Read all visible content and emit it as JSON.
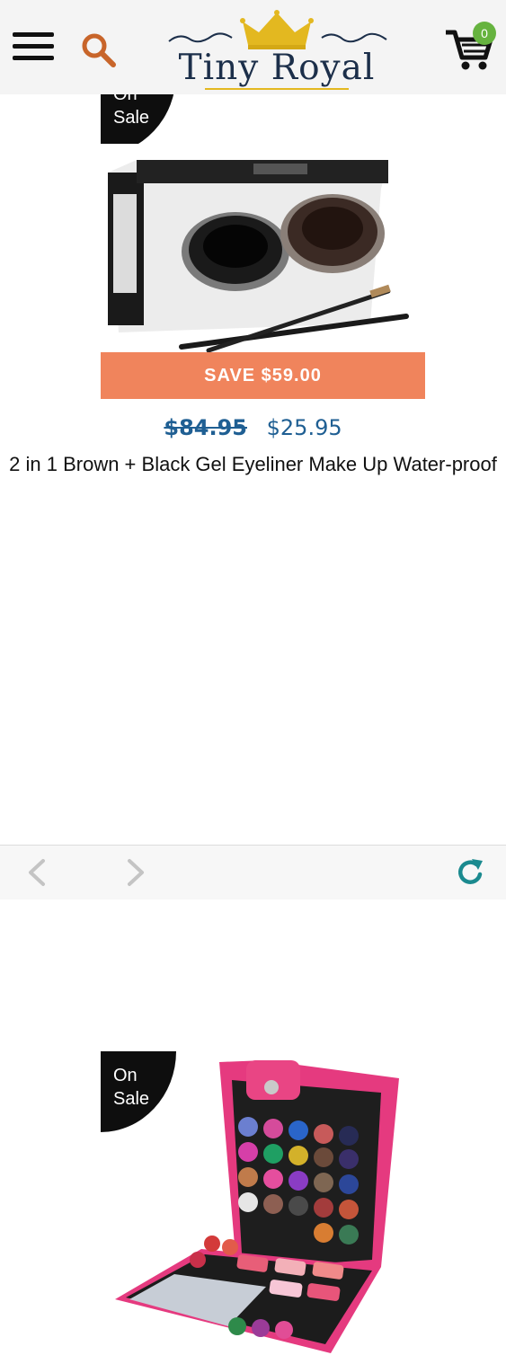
{
  "header": {
    "brand": "Tiny Royal",
    "cart_count": "0",
    "icons": {
      "menu": "hamburger-menu-icon",
      "search": "search-icon",
      "cart": "shopping-cart-icon",
      "crown": "crown-icon"
    }
  },
  "colors": {
    "header_bg": "#f4f4f4",
    "brand_navy": "#1c2f4a",
    "crown_gold": "#e3b820",
    "search_orange": "#c8652a",
    "badge_green": "#66b33f",
    "save_orange": "#f0845c",
    "price_blue": "#1f5f93",
    "refresh_teal": "#1b8a8f"
  },
  "products": [
    {
      "ribbon": [
        "On",
        "Sale"
      ],
      "save_label": "SAVE $59.00",
      "price_old": "$84.95",
      "price_new": "$25.95",
      "title": "2 in 1 Brown + Black Gel Eyeliner Make Up Water-proof",
      "image": "eyeliner-kit-image"
    },
    {
      "ribbon": [
        "On",
        "Sale"
      ],
      "image": "makeup-palette-image"
    }
  ],
  "bottom_nav": {
    "icons": {
      "back": "back-arrow-icon",
      "forward": "forward-arrow-icon",
      "refresh": "refresh-icon"
    }
  }
}
